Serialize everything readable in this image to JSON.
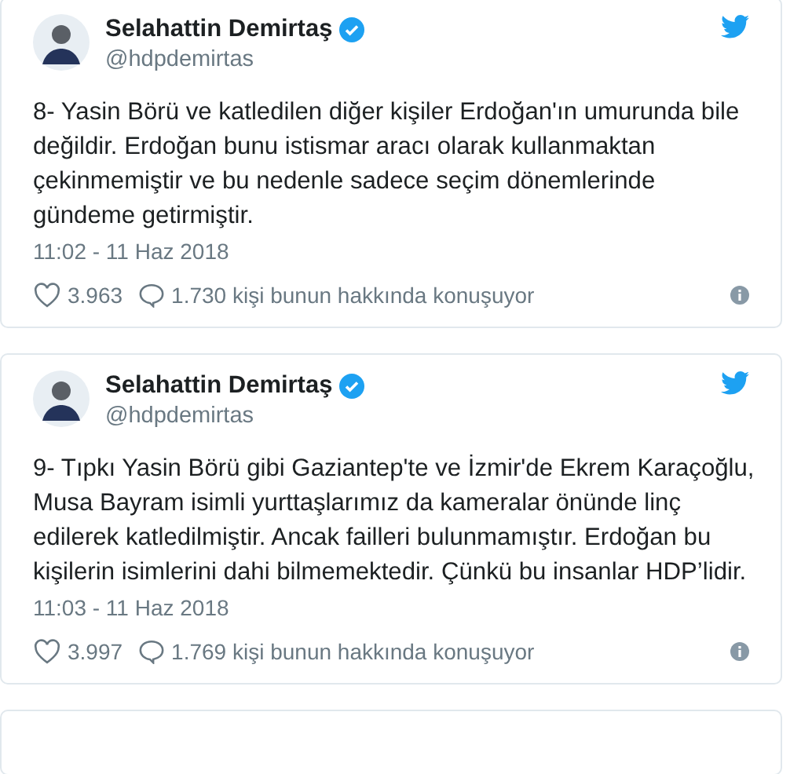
{
  "tweets": [
    {
      "kind": "tweet",
      "name": "Selahattin Demirtaş",
      "verified": true,
      "handle": "@hdpdemirtas",
      "text": "8- Yasin Börü ve katledilen diğer kişiler Erdoğan'ın umurunda bile değildir. Erdoğan bunu istismar aracı olarak kullanmaktan çekinmemiştir ve bu nedenle sadece seçim dönemlerinde gündeme getirmiştir.",
      "time": "11:02 - 11 Haz 2018",
      "likes": "3.963",
      "replies": "1.730 kişi bunun hakkında konuşuyor"
    },
    {
      "kind": "tweet",
      "name": "Selahattin Demirtaş",
      "verified": true,
      "handle": "@hdpdemirtas",
      "text": "9- Tıpkı Yasin Börü gibi Gaziantep'te ve İzmir'de Ekrem Karaçoğlu, Musa Bayram isimli yurttaşlarımız da kameralar önünde linç edilerek katledilmiştir. Ancak failleri bulunmamıştır. Erdoğan bu kişilerin isimlerini dahi bilmemektedir. Çünkü bu insanlar HDP’lidir.",
      "time": "11:03 - 11 Haz 2018",
      "likes": "3.997",
      "replies": "1.769 kişi bunun hakkında konuşuyor"
    },
    {
      "kind": "stub"
    }
  ]
}
